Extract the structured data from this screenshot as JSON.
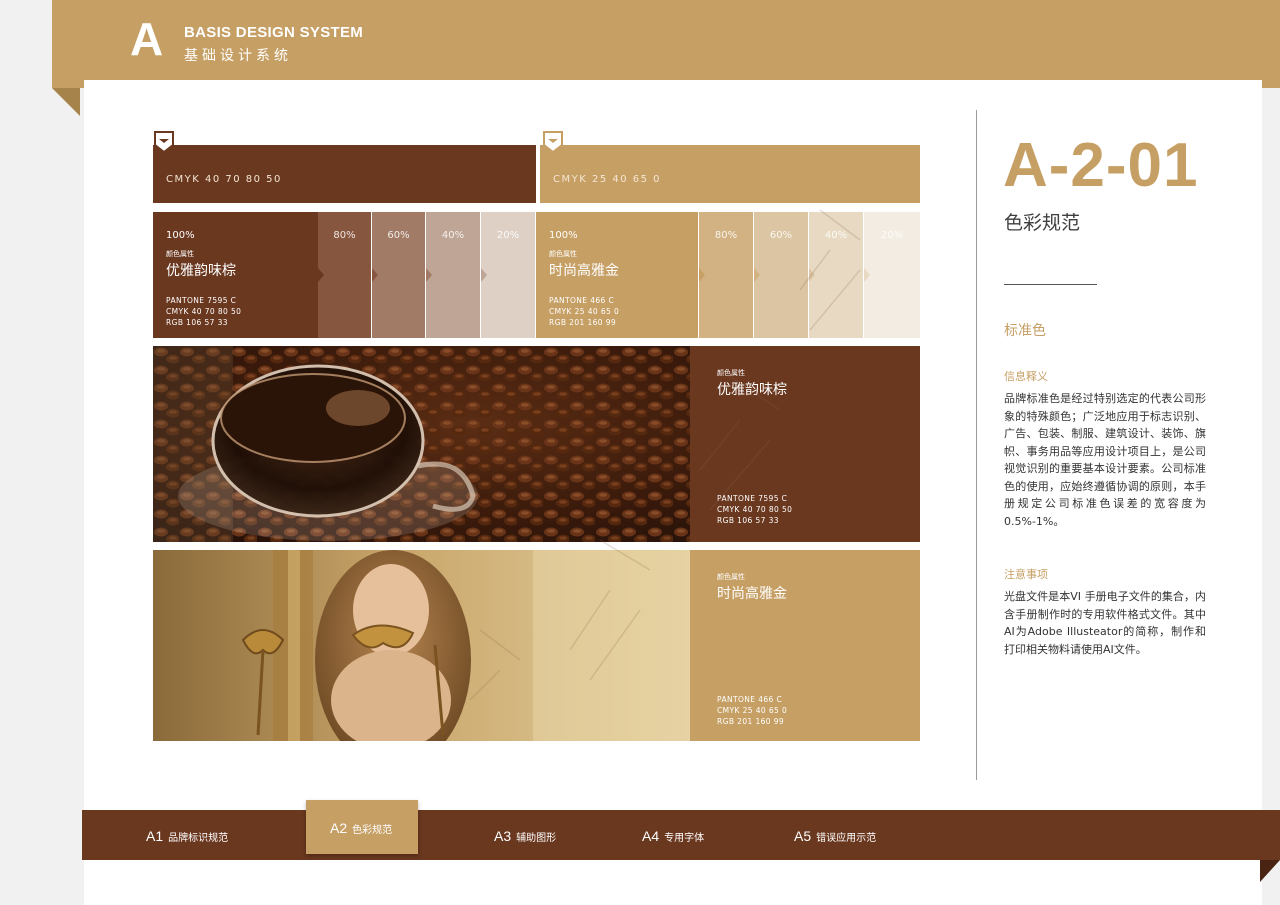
{
  "header": {
    "letter": "A",
    "title_en": "BASIS DESIGN SYSTEM",
    "title_cn": "基础设计系统"
  },
  "colors": {
    "brown": "#6a371f",
    "gold": "#c69f64",
    "white": "#ffffff"
  },
  "swatches": {
    "brown": {
      "cmyk_line": "CMYK  40  70  80  50"
    },
    "gold": {
      "cmyk_line": "CMYK  25  40  65  0"
    }
  },
  "tints": {
    "brown": {
      "main_pct": "100%",
      "attr_label": "颜色属性",
      "name": "优雅韵味棕",
      "pantone": "PANTONE 7595 C",
      "cmyk": "CMYK  40  70  80  50",
      "rgb": "RGB  106  57  33",
      "steps": [
        {
          "pct": "80%",
          "color": "#87563f"
        },
        {
          "pct": "60%",
          "color": "#a27b67"
        },
        {
          "pct": "40%",
          "color": "#bea595"
        },
        {
          "pct": "20%",
          "color": "#dfd0c6"
        }
      ]
    },
    "gold": {
      "main_pct": "100%",
      "attr_label": "颜色属性",
      "name": "时尚高雅金",
      "pantone": "PANTONE 466 C",
      "cmyk": "CMYK  25 40 65 0",
      "rgb": "RGB  201 160 99",
      "steps": [
        {
          "pct": "80%",
          "color": "#d2b283"
        },
        {
          "pct": "60%",
          "color": "#dcc5a2"
        },
        {
          "pct": "40%",
          "color": "#e8d9c3"
        },
        {
          "pct": "20%",
          "color": "#f3ece2"
        }
      ]
    }
  },
  "photos": {
    "coffee": {
      "attr_label": "颜色属性",
      "name": "优雅韵味棕",
      "pantone": "PANTONE 7595 C",
      "cmyk": "CMYK  40  70  80  50",
      "rgb": "RGB  106  57  33"
    },
    "woman": {
      "attr_label": "颜色属性",
      "name": "时尚高雅金",
      "pantone": "PANTONE 466 C",
      "cmyk": "CMYK  25 40 65 0",
      "rgb": "RGB  201 160 99"
    }
  },
  "sidebar": {
    "code": "A-2-01",
    "subtitle": "色彩规范",
    "section_title": "标准色",
    "info_label": "信息释义",
    "info_text": "品牌标准色是经过特别选定的代表公司形象的特殊颜色；广泛地应用于标志识别、广告、包装、制服、建筑设计、装饰、旗帜、事务用品等应用设计项目上，是公司视觉识别的重要基本设计要素。公司标准色的使用，应始终遵循协调的原则，本手册规定公司标准色误差的宽容度为0.5%-1%。",
    "note_label": "注意事项",
    "note_text": "光盘文件是本VI 手册电子文件的集合，内含手册制作时的专用软件格式文件。其中AI为Adobe Illusteator的简称，制作和打印相关物料请使用AI文件。"
  },
  "nav": [
    {
      "num": "A1",
      "label": "品牌标识规范"
    },
    {
      "num": "A2",
      "label": "色彩规范"
    },
    {
      "num": "A3",
      "label": "辅助图形"
    },
    {
      "num": "A4",
      "label": "专用字体"
    },
    {
      "num": "A5",
      "label": "错误应用示范"
    }
  ]
}
